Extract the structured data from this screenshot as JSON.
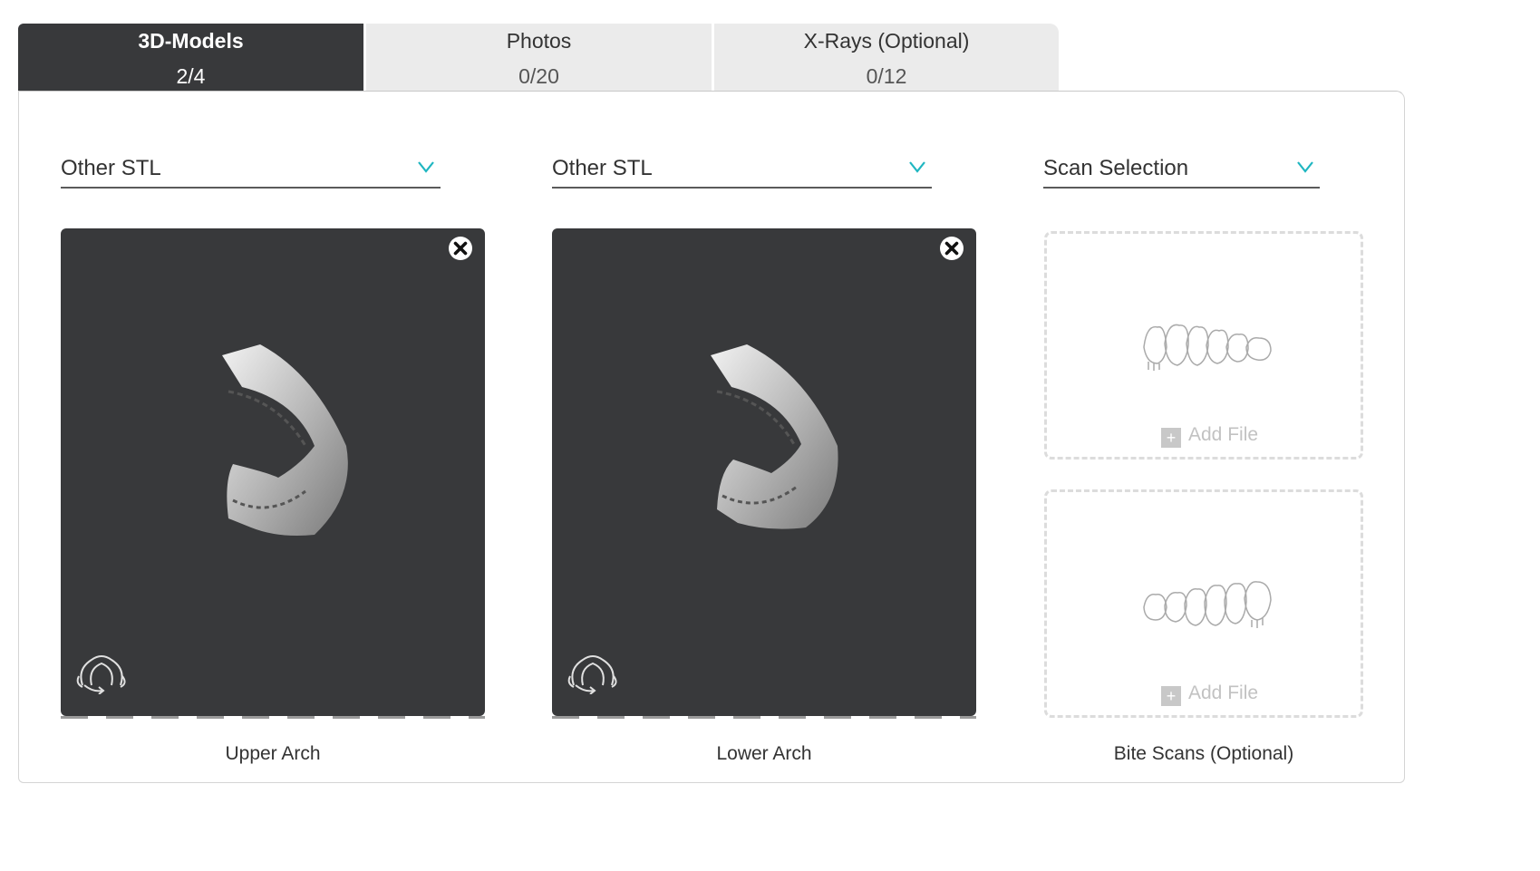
{
  "tabs": [
    {
      "name": "3D-Models",
      "count": "2/4",
      "active": true
    },
    {
      "name": "Photos",
      "count": "0/20",
      "active": false
    },
    {
      "name": "X-Rays (Optional)",
      "count": "0/12",
      "active": false
    }
  ],
  "columns": [
    {
      "dropdown": "Other STL",
      "caption": "Upper Arch"
    },
    {
      "dropdown": "Other STL",
      "caption": "Lower Arch"
    },
    {
      "dropdown": "Scan Selection",
      "caption": "Bite Scans (Optional)"
    }
  ],
  "slots": [
    {
      "add_label": "Add File",
      "icon": "upper-teeth-icon"
    },
    {
      "add_label": "Add File",
      "icon": "lower-teeth-icon"
    }
  ],
  "icons": {
    "close": "close-icon",
    "rotate": "rotate-3d-icon",
    "chevron": "chevron-down-icon",
    "plus": "plus-icon"
  },
  "colors": {
    "accent": "#1fb6c1",
    "dark": "#38393b",
    "tab_bg": "#ebebeb"
  }
}
